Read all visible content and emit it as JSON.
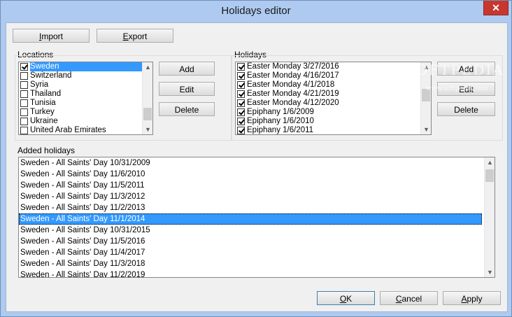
{
  "window": {
    "title": "Holidays editor",
    "close_glyph": "✕"
  },
  "toolbar": {
    "import_label": "Import",
    "export_label": "Export"
  },
  "locations": {
    "label": "Locations",
    "items": [
      {
        "label": "Sweden",
        "checked": true
      },
      {
        "label": "Switzerland",
        "checked": false
      },
      {
        "label": "Syria",
        "checked": false
      },
      {
        "label": "Thailand",
        "checked": false
      },
      {
        "label": "Tunisia",
        "checked": false
      },
      {
        "label": "Turkey",
        "checked": false
      },
      {
        "label": "Ukraine",
        "checked": false
      },
      {
        "label": "United Arab Emirates",
        "checked": false
      }
    ],
    "add_label": "Add",
    "edit_label": "Edit",
    "delete_label": "Delete"
  },
  "holidays": {
    "label": "Holidays",
    "items": [
      {
        "label": "Easter Monday 3/27/2016",
        "checked": true
      },
      {
        "label": "Easter Monday 4/16/2017",
        "checked": true
      },
      {
        "label": "Easter Monday 4/1/2018",
        "checked": true
      },
      {
        "label": "Easter Monday 4/21/2019",
        "checked": true
      },
      {
        "label": "Easter Monday 4/12/2020",
        "checked": true
      },
      {
        "label": "Epiphany 1/6/2009",
        "checked": true
      },
      {
        "label": "Epiphany 1/6/2010",
        "checked": true
      },
      {
        "label": "Epiphany 1/6/2011",
        "checked": true
      }
    ],
    "add_label": "Add",
    "edit_label": "Edit",
    "delete_label": "Delete"
  },
  "added": {
    "label": "Added holidays",
    "rows": [
      "Sweden - All Saints' Day 10/31/2009",
      "Sweden - All Saints' Day 11/6/2010",
      "Sweden - All Saints' Day 11/5/2011",
      "Sweden - All Saints' Day 11/3/2012",
      "Sweden - All Saints' Day 11/2/2013",
      "Sweden - All Saints' Day 11/1/2014",
      "Sweden - All Saints' Day 10/31/2015",
      "Sweden - All Saints' Day 11/5/2016",
      "Sweden - All Saints' Day 11/4/2017",
      "Sweden - All Saints' Day 11/3/2018",
      "Sweden - All Saints' Day 11/2/2019"
    ],
    "selected_index": 5
  },
  "footer": {
    "ok_label": "OK",
    "cancel_label": "Cancel",
    "apply_label": "Apply"
  },
  "watermark": {
    "text": "SOFTPEDIA",
    "sub": "www.softpedia.com"
  },
  "colors": {
    "selection": "#3399ff",
    "frame": "#aecaf0",
    "close": "#c7372f"
  }
}
